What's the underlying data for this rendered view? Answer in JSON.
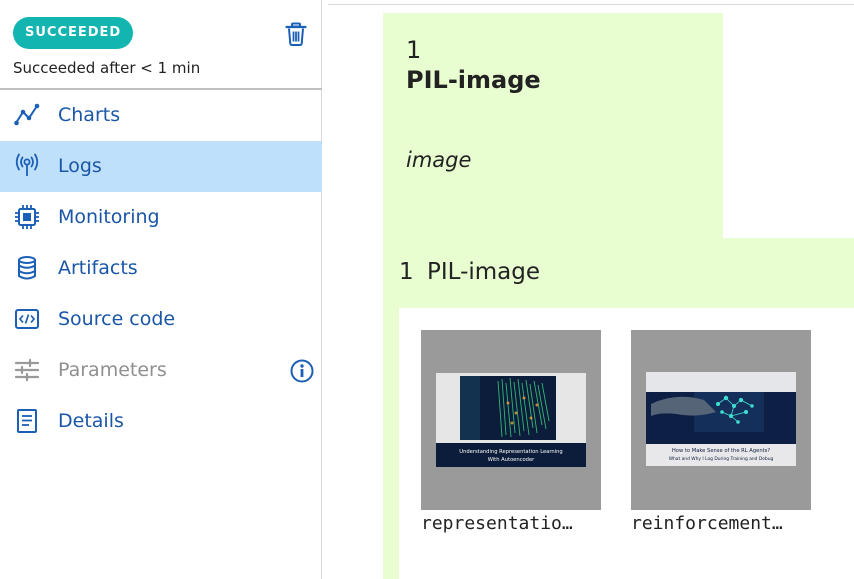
{
  "run": {
    "status": "SUCCEEDED",
    "duration": "Succeeded after < 1 min"
  },
  "sidebar": {
    "items": [
      {
        "label": "Charts",
        "icon": "chart-line-icon"
      },
      {
        "label": "Logs",
        "icon": "broadcast-icon"
      },
      {
        "label": "Monitoring",
        "icon": "chip-icon"
      },
      {
        "label": "Artifacts",
        "icon": "database-icon"
      },
      {
        "label": "Source code",
        "icon": "code-icon"
      },
      {
        "label": "Parameters",
        "icon": "sliders-icon"
      },
      {
        "label": "Details",
        "icon": "document-icon"
      }
    ],
    "active_index": 1
  },
  "main": {
    "step_number": "1",
    "title": "PIL-image",
    "subtitle": "image",
    "group_number": "1",
    "group_title": "PIL-image",
    "images": [
      {
        "caption": "representatio…",
        "thumb_lines": [
          "Understanding Representation Learning",
          "With Autoencoder"
        ]
      },
      {
        "caption": "reinforcement…",
        "thumb_lines": [
          "How to Make Sense of the RL Agents?",
          "What and Why I Log During Training and Debug"
        ]
      }
    ]
  },
  "colors": {
    "accent": "#1b5fb6",
    "badge": "#13b5b1",
    "active_row": "#bfe0fb",
    "panel": "#e8fdd0"
  }
}
